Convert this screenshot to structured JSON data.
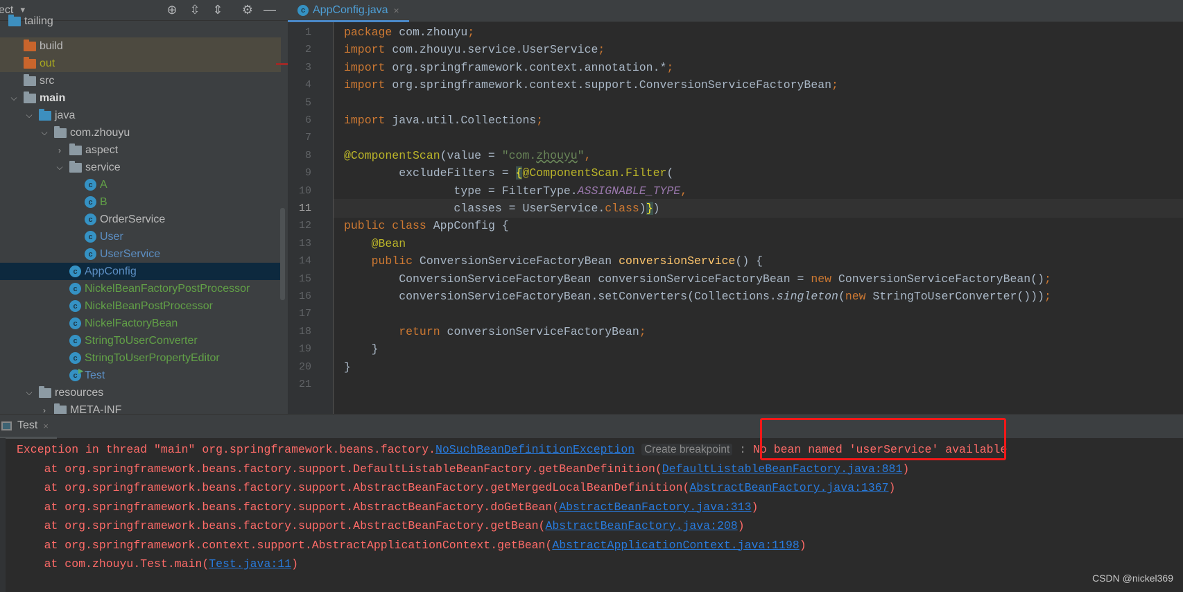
{
  "sidebar": {
    "title": "ect",
    "tools": [
      {
        "icon": "locate-icon",
        "glyph": "⊕"
      },
      {
        "icon": "expand-all-icon",
        "glyph": "⇳"
      },
      {
        "icon": "collapse-all-icon",
        "glyph": "⇕"
      },
      {
        "icon": "gear-icon",
        "glyph": "⚙"
      },
      {
        "icon": "minimize-icon",
        "glyph": "—"
      }
    ],
    "tree": [
      {
        "label": "tailing",
        "level": 0,
        "type": "module",
        "arrow": "",
        "color": "#bbbbbb",
        "partial": true
      },
      {
        "label": "build",
        "level": 1,
        "type": "folder-excluded",
        "arrow": "",
        "color": "#bbbbbb",
        "excluded": true
      },
      {
        "label": "out",
        "level": 1,
        "type": "folder-excluded",
        "arrow": "",
        "color": "#a8a820",
        "excluded": true
      },
      {
        "label": "src",
        "level": 1,
        "type": "folder",
        "arrow": "",
        "color": "#bbbbbb"
      },
      {
        "label": "main",
        "level": 1,
        "type": "folder-source",
        "arrow": "down",
        "color": "#dddddd",
        "bold": true
      },
      {
        "label": "java",
        "level": 2,
        "type": "folder-java",
        "arrow": "down",
        "color": "#bbbbbb"
      },
      {
        "label": "com.zhouyu",
        "level": 3,
        "type": "package",
        "arrow": "down",
        "color": "#bbbbbb"
      },
      {
        "label": "aspect",
        "level": 4,
        "type": "package",
        "arrow": "right",
        "color": "#bbbbbb"
      },
      {
        "label": "service",
        "level": 4,
        "type": "package",
        "arrow": "down",
        "color": "#bbbbbb"
      },
      {
        "label": "A",
        "level": 5,
        "type": "class",
        "arrow": "",
        "color": "#62a147"
      },
      {
        "label": "B",
        "level": 5,
        "type": "class",
        "arrow": "",
        "color": "#62a147"
      },
      {
        "label": "OrderService",
        "level": 5,
        "type": "class",
        "arrow": "",
        "color": "#bbbbbb"
      },
      {
        "label": "User",
        "level": 5,
        "type": "class",
        "arrow": "",
        "color": "#5c8fc4"
      },
      {
        "label": "UserService",
        "level": 5,
        "type": "class",
        "arrow": "",
        "color": "#5c8fc4"
      },
      {
        "label": "AppConfig",
        "level": 4,
        "type": "class",
        "arrow": "",
        "color": "#5c8fc4",
        "selected": true
      },
      {
        "label": "NickelBeanFactoryPostProcessor",
        "level": 4,
        "type": "class",
        "arrow": "",
        "color": "#62a147"
      },
      {
        "label": "NickelBeanPostProcessor",
        "level": 4,
        "type": "class",
        "arrow": "",
        "color": "#62a147"
      },
      {
        "label": "NickelFactoryBean",
        "level": 4,
        "type": "class",
        "arrow": "",
        "color": "#62a147"
      },
      {
        "label": "StringToUserConverter",
        "level": 4,
        "type": "class",
        "arrow": "",
        "color": "#62a147"
      },
      {
        "label": "StringToUserPropertyEditor",
        "level": 4,
        "type": "class",
        "arrow": "",
        "color": "#62a147"
      },
      {
        "label": "Test",
        "level": 4,
        "type": "class-runnable",
        "arrow": "",
        "color": "#5c8fc4"
      },
      {
        "label": "resources",
        "level": 2,
        "type": "folder-resources",
        "arrow": "down",
        "color": "#bbbbbb"
      },
      {
        "label": "META-INF",
        "level": 3,
        "type": "folder",
        "arrow": "right",
        "color": "#bbbbbb"
      }
    ]
  },
  "editor": {
    "tab": {
      "label": "AppConfig.java",
      "icon": "class-icon",
      "close": "×"
    },
    "current_line": 11,
    "lines": [
      [
        [
          "package",
          "kw"
        ],
        [
          " com.zhouyu",
          ""
        ],
        [
          ";",
          "kw"
        ]
      ],
      [
        [
          "import",
          "kw"
        ],
        [
          " com.zhouyu.service.UserService",
          ""
        ],
        [
          ";",
          "kw"
        ]
      ],
      [
        [
          "import",
          "kw"
        ],
        [
          " org.springframework.context.annotation.*",
          ""
        ],
        [
          ";",
          "kw"
        ]
      ],
      [
        [
          "import",
          "kw"
        ],
        [
          " org.springframework.context.support.ConversionServiceFactoryBean",
          ""
        ],
        [
          ";",
          "kw"
        ]
      ],
      [],
      [
        [
          "import",
          "kw"
        ],
        [
          " java.util.Collections",
          ""
        ],
        [
          ";",
          "kw"
        ]
      ],
      [],
      [
        [
          "@ComponentScan",
          "ann"
        ],
        [
          "(value = ",
          ""
        ],
        [
          "\"com.",
          "str"
        ],
        [
          "zhouyu",
          "str sq"
        ],
        [
          "\"",
          "str"
        ],
        [
          ",",
          "kw"
        ]
      ],
      [
        [
          "        excludeFilters = ",
          ""
        ],
        [
          "{",
          "brace"
        ],
        [
          "@ComponentScan.Filter",
          "ann"
        ],
        [
          "(",
          ""
        ]
      ],
      [
        [
          "                type = FilterType.",
          ""
        ],
        [
          "ASSIGNABLE_TYPE",
          "cst"
        ],
        [
          ",",
          "kw"
        ]
      ],
      [
        [
          "                classes = UserService.",
          ""
        ],
        [
          "class",
          "kw"
        ],
        [
          ")",
          ""
        ],
        [
          "}",
          "brace"
        ],
        [
          ")",
          ""
        ]
      ],
      [
        [
          "public class",
          "kw"
        ],
        [
          " AppConfig {",
          ""
        ]
      ],
      [
        [
          "    ",
          ""
        ],
        [
          "@Bean",
          "ann"
        ]
      ],
      [
        [
          "    ",
          ""
        ],
        [
          "public",
          "kw"
        ],
        [
          " ConversionServiceFactoryBean ",
          ""
        ],
        [
          "conversionService",
          "fn"
        ],
        [
          "() {",
          ""
        ]
      ],
      [
        [
          "        ConversionServiceFactoryBean conversionServiceFactoryBean = ",
          ""
        ],
        [
          "new",
          "kw"
        ],
        [
          " ConversionServiceFactoryBean()",
          ""
        ],
        [
          ";",
          "kw"
        ]
      ],
      [
        [
          "        conversionServiceFactoryBean.setConverters(Collections.",
          ""
        ],
        [
          "singleton",
          "it"
        ],
        [
          "(",
          ""
        ],
        [
          "new",
          "kw"
        ],
        [
          " StringToUserConverter()))",
          ""
        ],
        [
          ";",
          "kw"
        ]
      ],
      [],
      [
        [
          "        ",
          ""
        ],
        [
          "return",
          "kw"
        ],
        [
          " conversionServiceFactoryBean",
          ""
        ],
        [
          ";",
          "kw"
        ]
      ],
      [
        [
          "    }",
          ""
        ]
      ],
      [
        [
          "}",
          ""
        ]
      ],
      []
    ]
  },
  "console": {
    "tab": {
      "label": "Test",
      "close": "×"
    },
    "lines": [
      [
        [
          "Exception in thread \"main\" org.springframework.beans.factory.",
          ""
        ],
        [
          "NoSuchBeanDefinitionException",
          "lnk"
        ],
        [
          " ",
          ""
        ],
        [
          "Create breakpoint",
          "hint"
        ],
        [
          " : ",
          "dim"
        ],
        [
          "No bean named 'userService' available",
          ""
        ]
      ],
      [
        [
          "    at org.springframework.beans.factory.support.DefaultListableBeanFactory.getBeanDefinition(",
          ""
        ],
        [
          "DefaultListableBeanFactory.java:881",
          "lnk"
        ],
        [
          ")",
          ""
        ]
      ],
      [
        [
          "    at org.springframework.beans.factory.support.AbstractBeanFactory.getMergedLocalBeanDefinition(",
          ""
        ],
        [
          "AbstractBeanFactory.java:1367",
          "lnk"
        ],
        [
          ")",
          ""
        ]
      ],
      [
        [
          "    at org.springframework.beans.factory.support.AbstractBeanFactory.doGetBean(",
          ""
        ],
        [
          "AbstractBeanFactory.java:313",
          "lnk"
        ],
        [
          ")",
          ""
        ]
      ],
      [
        [
          "    at org.springframework.beans.factory.support.AbstractBeanFactory.getBean(",
          ""
        ],
        [
          "AbstractBeanFactory.java:208",
          "lnk"
        ],
        [
          ")",
          ""
        ]
      ],
      [
        [
          "    at org.springframework.context.support.AbstractApplicationContext.getBean(",
          ""
        ],
        [
          "AbstractApplicationContext.java:1198",
          "lnk"
        ],
        [
          ")",
          ""
        ]
      ],
      [
        [
          "    at com.zhouyu.Test.main(",
          ""
        ],
        [
          "Test.java:11",
          "lnk"
        ],
        [
          ")",
          ""
        ]
      ]
    ],
    "highlight_color": "#f21818"
  },
  "watermark": "CSDN @nickel369",
  "colors": {
    "keyword": "#cc7832",
    "string": "#6a8759",
    "annotation": "#bbb529",
    "method": "#ffc66d",
    "constant": "#9876aa",
    "error": "#ff6b68",
    "link": "#287bde"
  }
}
